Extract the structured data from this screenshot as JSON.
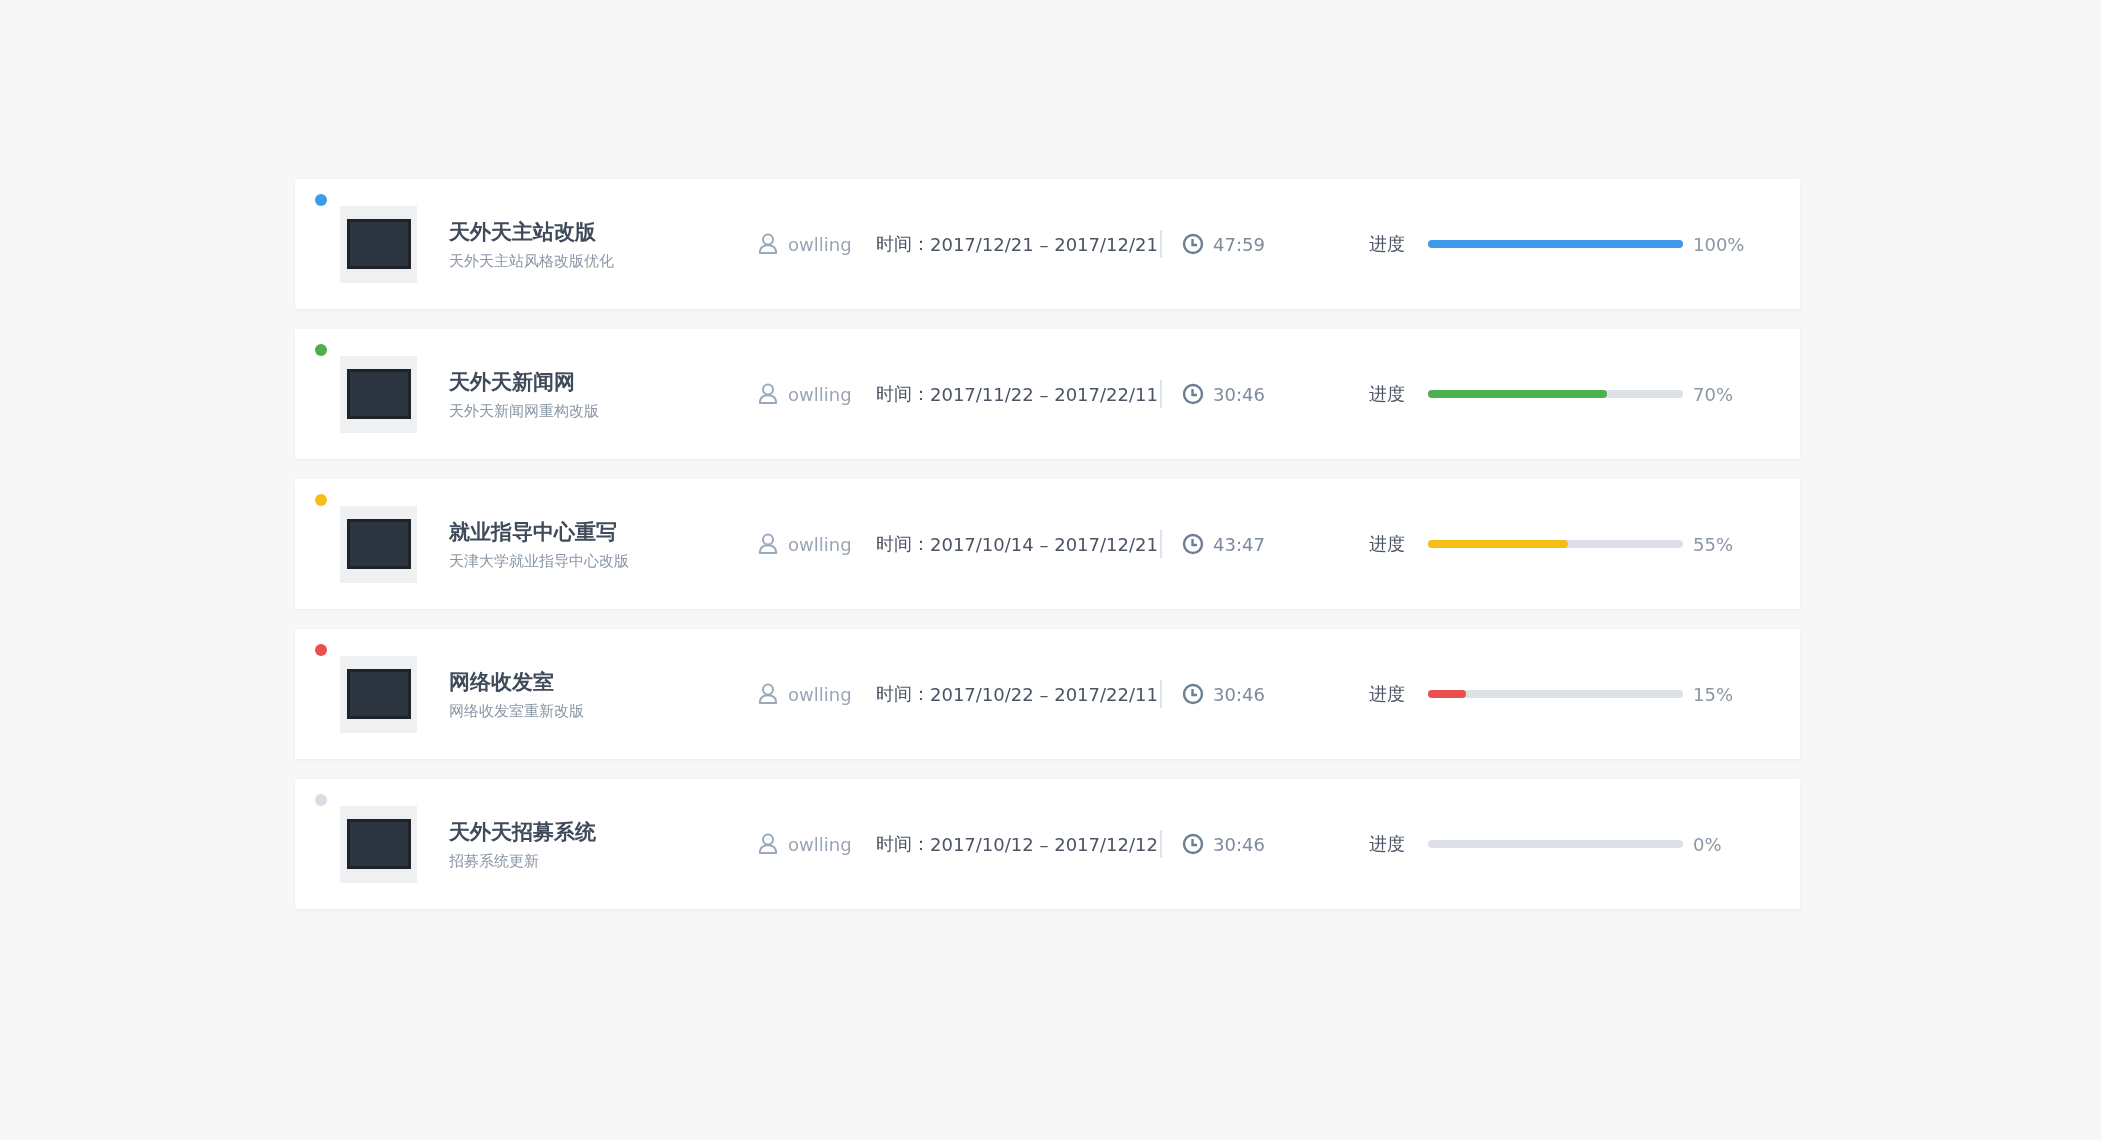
{
  "projects": [
    {
      "title": "天外天主站改版",
      "subtitle": "天外天主站风格改版优化",
      "owner": "owlling",
      "time_label": "时间：",
      "dates": "2017/12/21 – 2017/12/21",
      "duration": "47:59",
      "progress_label": "进度",
      "level": 1,
      "percent": "100%",
      "color": "#3d9be9"
    },
    {
      "title": "天外天新闻网",
      "subtitle": "天外天新闻网重构改版",
      "owner": "owlling",
      "time_label": "时间：",
      "dates": "2017/11/22 – 2017/22/11",
      "duration": "30:46",
      "progress_label": "进度",
      "level": 0.7,
      "percent": "70%",
      "color": "#4caf50"
    },
    {
      "title": "就业指导中心重写",
      "subtitle": "天津大学就业指导中心改版",
      "owner": "owlling",
      "time_label": "时间：",
      "dates": "2017/10/14 – 2017/12/21",
      "duration": "43:47",
      "progress_label": "进度",
      "level": 0.55,
      "percent": "55%",
      "color": "#f5bd16"
    },
    {
      "title": "网络收发室",
      "subtitle": "网络收发室重新改版",
      "owner": "owlling",
      "time_label": "时间：",
      "dates": "2017/10/22 – 2017/22/11",
      "duration": "30:46",
      "progress_label": "进度",
      "level": 0.15,
      "percent": "15%",
      "color": "#e94f4f"
    },
    {
      "title": "天外天招募系统",
      "subtitle": "招募系统更新",
      "owner": "owlling",
      "time_label": "时间：",
      "dates": "2017/10/12 – 2017/12/12",
      "duration": "30:46",
      "progress_label": "进度",
      "level": 0,
      "percent": "0%",
      "color": "#d6dde6"
    }
  ]
}
